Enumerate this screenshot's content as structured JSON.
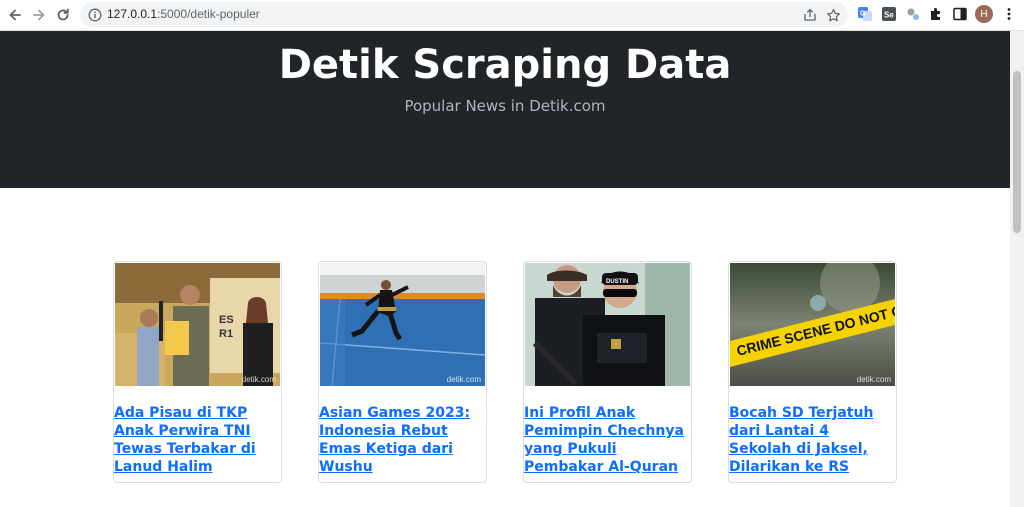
{
  "browser": {
    "url_host": "127.0.0.1",
    "url_rest": ":5000/detik-populer",
    "avatar_initial": "H"
  },
  "hero": {
    "title": "Detik Scraping Data",
    "subtitle": "Popular News in Detik.com"
  },
  "articles": [
    {
      "title": "Ada Pisau di TKP Anak Perwira TNI Tewas Terbakar di Lanud Halim",
      "watermark": "detik.com"
    },
    {
      "title": "Asian Games 2023: Indonesia Rebut Emas Ketiga dari Wushu",
      "watermark": "detik.com"
    },
    {
      "title": "Ini Profil Anak Pemimpin Chechnya yang Pukuli Pembakar Al-Quran",
      "watermark": "detik.com"
    },
    {
      "title": "Bocah SD Terjatuh dari Lantai 4 Sekolah di Jaksel, Dilarikan ke RS",
      "watermark": "detik.com"
    }
  ],
  "images": {
    "cap_text": "DUSTIN",
    "tape_text": "CRIME SCENE DO NOT C"
  },
  "colors": {
    "hero_bg": "#212529",
    "link": "#0d6efd",
    "tape": "#f5d300"
  }
}
